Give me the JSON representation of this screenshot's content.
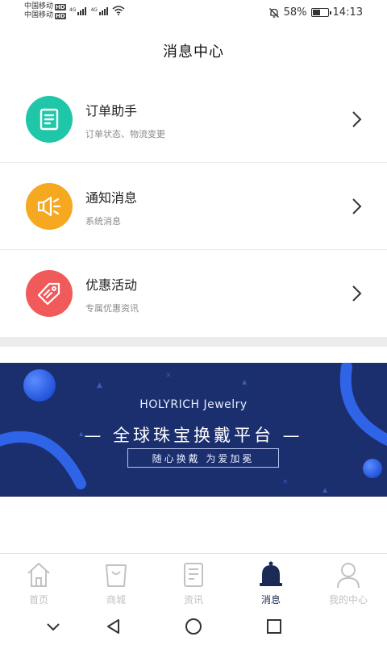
{
  "status_bar": {
    "carrier_1": "中国移动",
    "carrier_2": "中国移动",
    "hd_badge": "HD",
    "network_1": "4G",
    "network_2": "4G",
    "battery_percent": "58%",
    "battery_level": 0.58,
    "time": "14:13"
  },
  "header": {
    "title": "消息中心"
  },
  "messages": [
    {
      "title": "订单助手",
      "subtitle": "订单状态、物流变更",
      "icon": "document-icon",
      "color": "#1fc7a8"
    },
    {
      "title": "通知消息",
      "subtitle": "系统消息",
      "icon": "speaker-icon",
      "color": "#f6a821"
    },
    {
      "title": "优惠活动",
      "subtitle": "专属优惠资讯",
      "icon": "price-tag-icon",
      "color": "#f15a5b"
    }
  ],
  "banner": {
    "brand": "HOLYRICH Jewelry",
    "headline": "— 全球珠宝换戴平台 —",
    "tagline": "随心换戴 为爱加冕",
    "background": "#1b2f6e"
  },
  "bottom_nav": [
    {
      "label": "首页",
      "icon": "home-icon",
      "active": false
    },
    {
      "label": "商城",
      "icon": "shopping-bag-icon",
      "active": false
    },
    {
      "label": "资讯",
      "icon": "news-icon",
      "active": false
    },
    {
      "label": "消息",
      "icon": "bell-icon",
      "active": true
    },
    {
      "label": "我的中心",
      "icon": "user-icon",
      "active": false
    }
  ],
  "system_nav": [
    "back-chevron-icon",
    "triangle-back-icon",
    "circle-home-icon",
    "square-recents-icon"
  ],
  "colors": {
    "active_nav": "#1a2a54",
    "inactive_nav": "#c2c2c2"
  }
}
